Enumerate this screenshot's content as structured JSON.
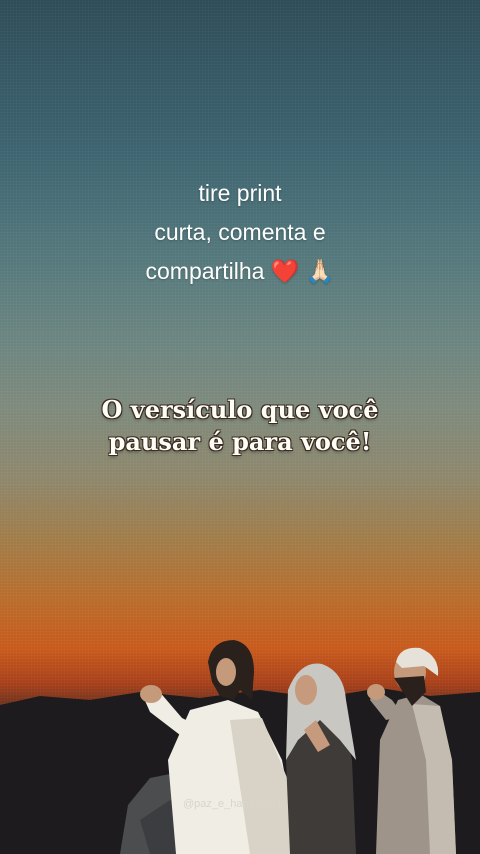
{
  "caption": {
    "line1": "tire print",
    "line2": "curta, comenta e",
    "line3_text": "compartilha",
    "line3_heart": "❤️",
    "line3_hands": "🙏🏻"
  },
  "verse": {
    "line1": "O versículo que você",
    "line2": "pausar é para você!"
  },
  "watermark": "@paz_e_harmonia1",
  "colors": {
    "sky_top": "#2d4c58",
    "sunset": "#c85a1c",
    "heart": "#e0142a"
  }
}
